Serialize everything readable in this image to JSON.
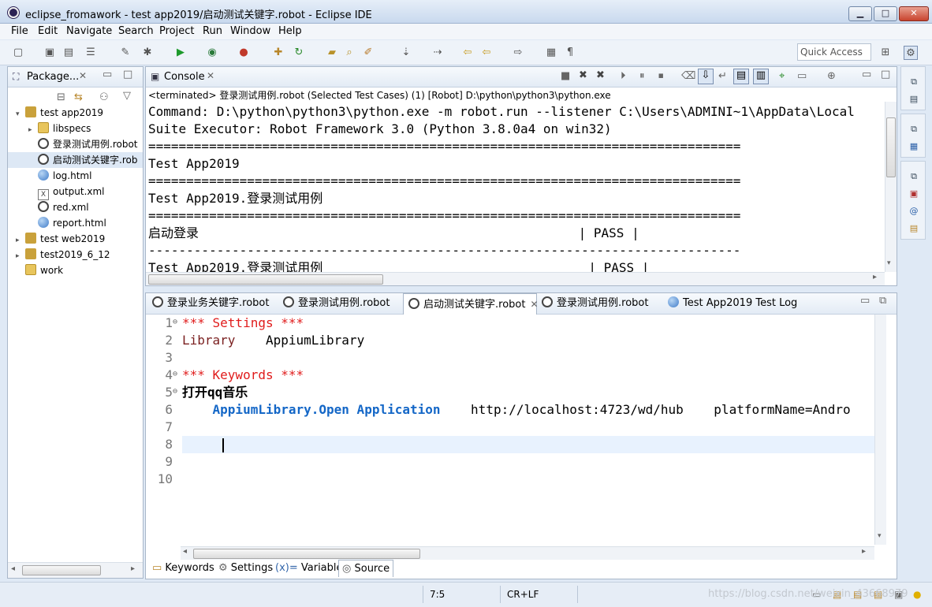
{
  "window": {
    "title": "eclipse_fromawork - test app2019/启动测试关键字.robot - Eclipse IDE",
    "minimize": "▁",
    "maximize": "□",
    "close": "✕"
  },
  "menu": [
    "File",
    "Edit",
    "Navigate",
    "Search",
    "Project",
    "Run",
    "Window",
    "Help"
  ],
  "toolbar": {
    "quick_access_placeholder": "Quick Access",
    "icons": [
      "new-icon",
      "save-icon",
      "save-all-icon",
      "properties-icon",
      "pin-icon",
      "debug-icon",
      "run-icon",
      "coverage-icon",
      "external-tools-icon",
      "new-project-icon",
      "refresh-icon",
      "open-folder-icon",
      "search-icon",
      "pen-icon",
      "annotation-nav-icon",
      "last-edit-icon",
      "back-icon",
      "forward-icon",
      "toggle-icon",
      "pilcrow-icon",
      "open-perspective-icon",
      "robot-perspective-icon"
    ]
  },
  "package_explorer": {
    "tab_label": "Package...",
    "items": [
      {
        "label": "test app2019",
        "kind": "project",
        "twist": "▾",
        "indent": 0
      },
      {
        "label": "libspecs",
        "kind": "folder",
        "twist": "▸",
        "indent": 1
      },
      {
        "label": "登录测试用例.robot",
        "kind": "robot",
        "twist": "",
        "indent": 1
      },
      {
        "label": "启动测试关键字.rob",
        "kind": "robot",
        "twist": "",
        "indent": 1,
        "selected": true
      },
      {
        "label": "log.html",
        "kind": "globe",
        "twist": "",
        "indent": 1
      },
      {
        "label": "output.xml",
        "kind": "xml",
        "twist": "",
        "indent": 1
      },
      {
        "label": "red.xml",
        "kind": "robot",
        "twist": "",
        "indent": 1
      },
      {
        "label": "report.html",
        "kind": "globe",
        "twist": "",
        "indent": 1
      },
      {
        "label": "test web2019",
        "kind": "project",
        "twist": "▸",
        "indent": 0
      },
      {
        "label": "test2019_6_12",
        "kind": "project",
        "twist": "▸",
        "indent": 0
      },
      {
        "label": "work",
        "kind": "folder",
        "twist": "",
        "indent": 0
      }
    ]
  },
  "console": {
    "tab_label": "Console",
    "description": "<terminated> 登录测试用例.robot (Selected Test Cases) (1) [Robot] D:\\python\\python3\\python.exe",
    "lines": [
      "Command: D:\\python\\python3\\python.exe -m robot.run --listener C:\\Users\\ADMINI~1\\AppData\\Local",
      "Suite Executor: Robot Framework 3.0 (Python 3.8.0a4 on win32)",
      "==============================================================================",
      "Test App2019",
      "==============================================================================",
      "Test App2019.登录测试用例",
      "==============================================================================",
      "启动登录                                                  | PASS |",
      "------------------------------------------------------------------------------",
      "Test App2019.登录测试用例                                   | PASS |"
    ]
  },
  "editor": {
    "tabs": [
      {
        "label": "登录业务关键字.robot",
        "active": false
      },
      {
        "label": "登录测试用例.robot",
        "active": false
      },
      {
        "label": "启动测试关键字.robot",
        "active": true
      },
      {
        "label": "登录测试用例.robot",
        "active": false
      },
      {
        "label": "Test App2019 Test Log",
        "active": false
      }
    ],
    "line_numbers": [
      "1",
      "2",
      "3",
      "4",
      "5",
      "6",
      "7",
      "8",
      "9",
      "10"
    ],
    "code": {
      "l1": "*** Settings ***",
      "l2_kw": "Library",
      "l2_val": "    AppiumLibrary",
      "l4": "*** Keywords ***",
      "l5": "打开qq音乐",
      "l6_kw": "    AppiumLibrary.Open Application",
      "l6_args": "    http://localhost:4723/wd/hub    platformName=Andro"
    },
    "bottom_tabs": [
      "Keywords",
      "Settings",
      "Variables",
      "Source"
    ]
  },
  "status": {
    "position": "7:5",
    "line_delimiter": "CR+LF",
    "watermark": "https://blog.csdn.net/weixin_43668979"
  }
}
